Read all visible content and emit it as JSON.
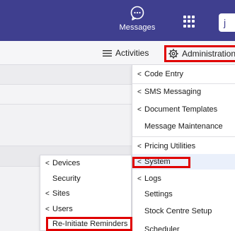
{
  "header": {
    "messages_label": "Messages",
    "avatar_letter": "j"
  },
  "subbar": {
    "activities_label": "Activities",
    "administration_label": "Administration"
  },
  "admin_menu": {
    "items": [
      {
        "label": "Code Entry",
        "chevron": "<"
      },
      {
        "label": "SMS Messaging",
        "chevron": "<"
      },
      {
        "label": "Document Templates",
        "chevron": "<"
      },
      {
        "label": "Message Maintenance",
        "chevron": ""
      },
      {
        "label": "Pricing Utilities",
        "chevron": "<"
      },
      {
        "label": "System",
        "chevron": "<"
      },
      {
        "label": "Logs",
        "chevron": "<"
      },
      {
        "label": "Settings",
        "chevron": ""
      },
      {
        "label": "Stock Centre Setup",
        "chevron": ""
      },
      {
        "label": "Scheduler",
        "chevron": ""
      }
    ]
  },
  "system_menu": {
    "items": [
      {
        "label": "Devices",
        "chevron": "<"
      },
      {
        "label": "Security",
        "chevron": ""
      },
      {
        "label": "Sites",
        "chevron": "<"
      },
      {
        "label": "Users",
        "chevron": "<"
      },
      {
        "label": "Re-Initiate Reminders",
        "chevron": ""
      }
    ]
  },
  "colors": {
    "header_bg": "#3f3f8f",
    "highlight_box": "#e00000"
  }
}
